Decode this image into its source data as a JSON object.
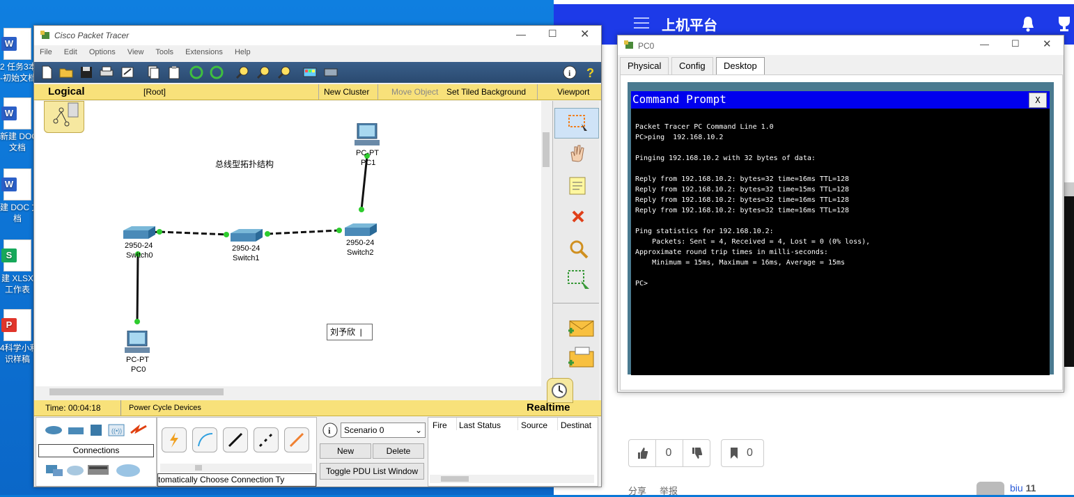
{
  "desktop": {
    "icons": [
      {
        "label1": "2 任务3本",
        "label2": "-初始文档",
        "type": "W",
        "color": "#2b5fc7"
      },
      {
        "label1": "新建 DOCX",
        "label2": "文档",
        "type": "W",
        "color": "#2b5fc7"
      },
      {
        "label1": "建 DOC 文",
        "label2": "档",
        "type": "W",
        "color": "#2b5fc7"
      },
      {
        "label1": "建 XLSX",
        "label2": "工作表",
        "type": "S",
        "color": "#17a85a"
      },
      {
        "label1": "4科学小利",
        "label2": "识样稿",
        "type": "P",
        "color": "#e0352b"
      }
    ]
  },
  "web": {
    "title": "上机平台",
    "like_count": "0",
    "bookmark_count": "0",
    "share": "分享",
    "report": "举报",
    "user": "biu",
    "user_num": "11"
  },
  "pt": {
    "title": "Cisco Packet Tracer",
    "menu": [
      "File",
      "Edit",
      "Options",
      "View",
      "Tools",
      "Extensions",
      "Help"
    ],
    "logical": "Logical",
    "root": "[Root]",
    "new_cluster": "New Cluster",
    "move_object": "Move Object",
    "set_tiled": "Set Tiled Background",
    "viewport": "Viewport",
    "canvas_title": "总线型拓扑结构",
    "note_text": "刘予欣",
    "devices": {
      "pc1_type": "PC-PT",
      "pc1_name": "PC1",
      "sw0_type": "2950-24",
      "sw0_name": "Switch0",
      "sw1_type": "2950-24",
      "sw1_name": "Switch1",
      "sw2_type": "2950-24",
      "sw2_name": "Switch2",
      "pc0_type": "PC-PT",
      "pc0_name": "PC0"
    },
    "time": "Time: 00:04:18",
    "power_cycle": "Power Cycle Devices",
    "realtime": "Realtime",
    "connections": "Connections",
    "auto_conn": "tomatically Choose Connection Ty",
    "scenario": "Scenario 0",
    "new_btn": "New",
    "delete_btn": "Delete",
    "toggle_pdu": "Toggle PDU List Window",
    "pdu_cols": [
      "Fire",
      "Last Status",
      "Source",
      "Destinat"
    ]
  },
  "pc0": {
    "title": "PC0",
    "tabs": [
      "Physical",
      "Config",
      "Desktop"
    ],
    "active_tab": "Desktop",
    "cmd_title": "Command Prompt",
    "close_x": "X",
    "lines": [
      "Packet Tracer PC Command Line 1.0",
      "PC>ping  192.168.10.2",
      "",
      "Pinging 192.168.10.2 with 32 bytes of data:",
      "",
      "Reply from 192.168.10.2: bytes=32 time=16ms TTL=128",
      "Reply from 192.168.10.2: bytes=32 time=15ms TTL=128",
      "Reply from 192.168.10.2: bytes=32 time=16ms TTL=128",
      "Reply from 192.168.10.2: bytes=32 time=16ms TTL=128",
      "",
      "Ping statistics for 192.168.10.2:",
      "    Packets: Sent = 4, Received = 4, Lost = 0 (0% loss),",
      "Approximate round trip times in milli-seconds:",
      "    Minimum = 15ms, Maximum = 16ms, Average = 15ms",
      "",
      "PC>"
    ]
  }
}
